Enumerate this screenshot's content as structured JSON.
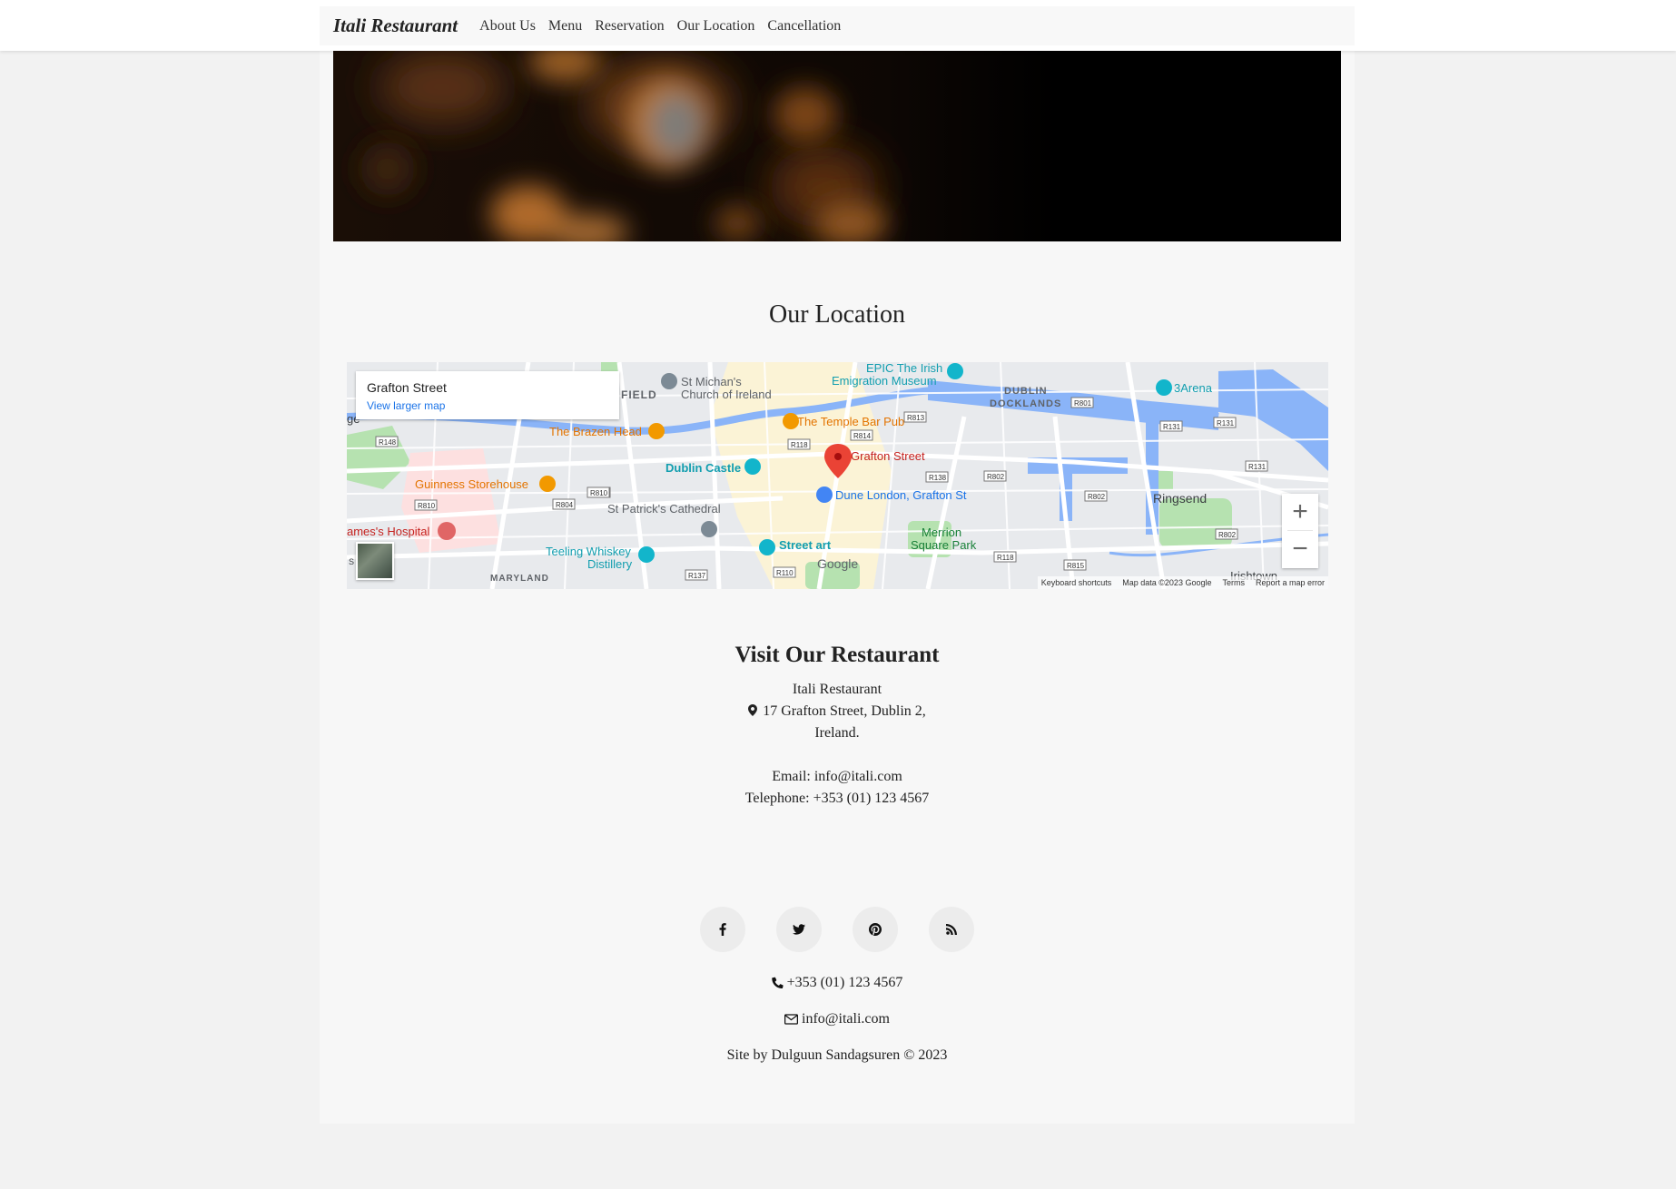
{
  "nav": {
    "brand": "Itali Restaurant",
    "links": [
      "About Us",
      "Menu",
      "Reservation",
      "Our Location",
      "Cancellation"
    ]
  },
  "location": {
    "title": "Our Location"
  },
  "map": {
    "card_place": "Grafton Street",
    "card_link": "View larger map",
    "zoom_in": "+",
    "zoom_out": "−",
    "labels": {
      "epic": "EPIC The Irish",
      "epic2": "Emigration Museum",
      "stmichans": "St Michan's",
      "stmichans2": "Church of Ireland",
      "field": "FIELD",
      "dublin": "DUBLIN",
      "docklands": "DOCKLANDS",
      "arena": "3Arena",
      "brazen": "The Brazen Head",
      "templebar": "The Temple Bar Pub",
      "grafton": "Grafton Street",
      "castle": "Dublin Castle",
      "guinness": "Guinness Storehouse",
      "dune": "Dune London, Grafton St",
      "ringsend": "Ringsend",
      "stpatricks": "St Patrick's Cathedral",
      "hospital": "ames's Hospital",
      "merrion": "Merrion",
      "merrion2": "Square Park",
      "teeling": "Teeling Whiskey",
      "teeling2": "Distillery",
      "streetart": "Street art",
      "maryland": "MARYLAND",
      "irishtown": "Irishtown",
      "ge": "ge",
      "s": "S"
    },
    "roads": [
      "R148",
      "R810",
      "R804",
      "R118",
      "R814",
      "R813",
      "R801",
      "R131",
      "R138",
      "R802",
      "R815",
      "R137",
      "R110",
      "R118",
      "R131",
      "R802",
      "R110",
      "R138"
    ],
    "footer": [
      "Keyboard shortcuts",
      "Map data ©2023 Google",
      "Terms",
      "Report a map error"
    ]
  },
  "visit": {
    "title": "Visit Our Restaurant",
    "name": "Itali Restaurant",
    "address1": "17 Grafton Street, Dublin 2,",
    "address2": "Ireland.",
    "email": "Email: info@itali.com",
    "telephone": "Telephone: +353 (01) 123 4567"
  },
  "footer": {
    "socials": [
      "facebook-icon",
      "twitter-icon",
      "pinterest-icon",
      "rss-icon"
    ],
    "phone": "+353 (01) 123 4567",
    "email": "info@itali.com",
    "credit": "Site by Dulguun Sandagsuren © 2023"
  }
}
